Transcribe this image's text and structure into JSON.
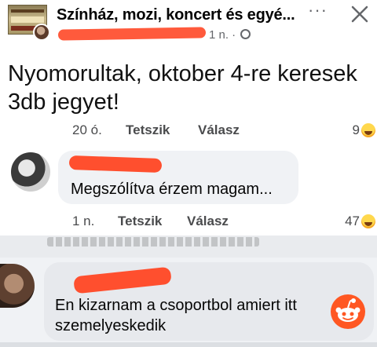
{
  "header": {
    "group_title": "Színház, mozi, koncert és egyé...",
    "post_time": "1 n. ·",
    "more_label": "···"
  },
  "post": {
    "text": "Nyomorultak, oktober 4-re keresek 3db jegyet!",
    "actions": {
      "time": "20 ó.",
      "like": "Tetszik",
      "reply": "Válasz",
      "reaction_count": "9"
    }
  },
  "comments": [
    {
      "text": "Megszólítva érzem magam...",
      "time": "1 n.",
      "like": "Tetszik",
      "reply": "Válasz",
      "reaction_count": "47"
    },
    {
      "text_line1": "En kizarnam a csoportbol amiert itt",
      "text_line2": "szemelyeskedik"
    }
  ],
  "colors": {
    "redaction": "#ff4f2e",
    "reddit_orange": "#ff5722",
    "muted_text": "#65676b",
    "bubble": "#f0f2f5"
  },
  "icons": [
    "group-thumbnail",
    "avatar",
    "more-icon",
    "close-icon",
    "globe-icon",
    "haha-emoji-icon",
    "reddit-icon"
  ]
}
